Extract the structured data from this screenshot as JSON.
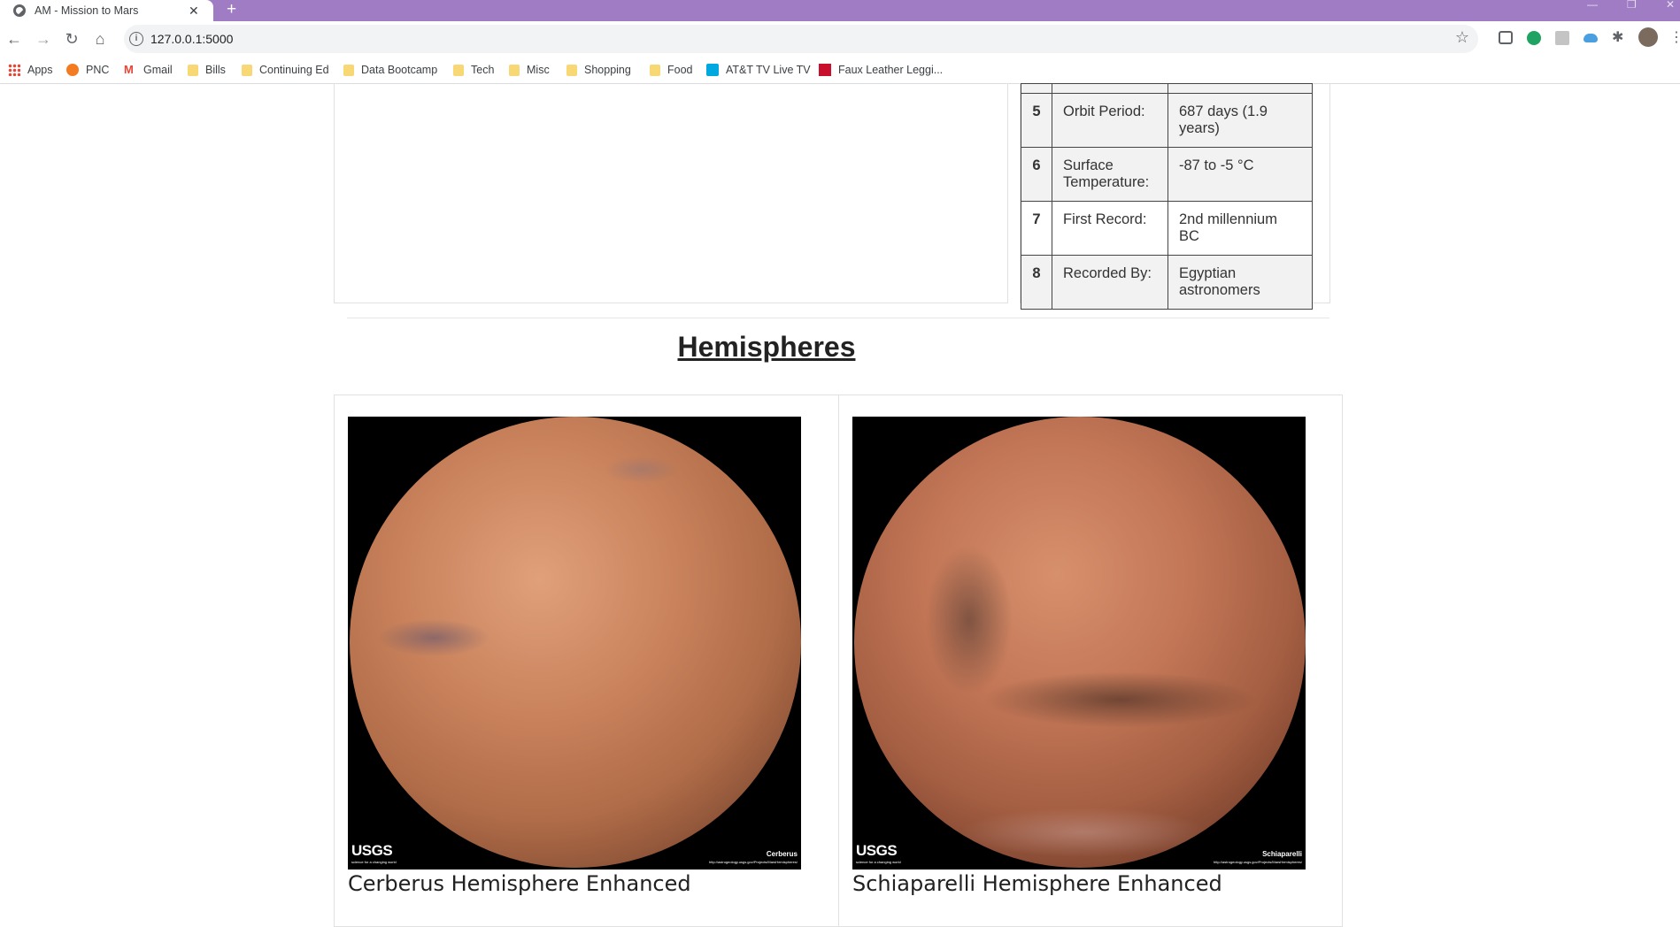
{
  "browser": {
    "tab_title": "AM - Mission to Mars",
    "tab_close": "✕",
    "new_tab": "+",
    "url": "127.0.0.1:5000",
    "win_minimize": "—",
    "win_restore": "❐",
    "win_close": "✕"
  },
  "bookmarks": [
    {
      "label": "Apps",
      "icon": "apps-grid-icon"
    },
    {
      "label": "PNC",
      "icon": "pnc-icon"
    },
    {
      "label": "Gmail",
      "icon": "gmail-icon"
    },
    {
      "label": "Bills",
      "icon": "folder-icon"
    },
    {
      "label": "Continuing Ed",
      "icon": "folder-icon"
    },
    {
      "label": "Data Bootcamp",
      "icon": "folder-icon"
    },
    {
      "label": "Tech",
      "icon": "folder-icon"
    },
    {
      "label": "Misc",
      "icon": "folder-icon"
    },
    {
      "label": "Shopping",
      "icon": "folder-icon"
    },
    {
      "label": "Food",
      "icon": "folder-icon"
    },
    {
      "label": "AT&T TV Live TV",
      "icon": "atttv-icon"
    },
    {
      "label": "Faux Leather Leggi...",
      "icon": "red-square-icon"
    }
  ],
  "facts_table": {
    "rows": [
      {
        "num": "5",
        "label": "Orbit Period:",
        "value": "687 days (1.9 years)"
      },
      {
        "num": "6",
        "label": "Surface Temperature:",
        "value": "-87 to -5 °C"
      },
      {
        "num": "7",
        "label": "First Record:",
        "value": "2nd millennium BC"
      },
      {
        "num": "8",
        "label": "Recorded By:",
        "value": "Egyptian astronomers"
      }
    ]
  },
  "hemispheres": {
    "heading": "Hemispheres",
    "items": [
      {
        "title": "Cerberus Hemisphere Enhanced",
        "image_label": "Cerberus",
        "logo": "USGS",
        "logo_tagline": "science for a changing world",
        "image_url_text": "http://astrogeology.usgs.gov/Projects/MarsHemispheres/"
      },
      {
        "title": "Schiaparelli Hemisphere Enhanced",
        "image_label": "Schiaparelli",
        "logo": "USGS",
        "logo_tagline": "science for a changing world",
        "image_url_text": "http://astrogeology.usgs.gov/Projects/MarsHemispheres/"
      }
    ]
  },
  "colors": {
    "tabstrip": "#a07cc5",
    "table_border": "#454545",
    "table_shade": "#f2f2f2"
  }
}
